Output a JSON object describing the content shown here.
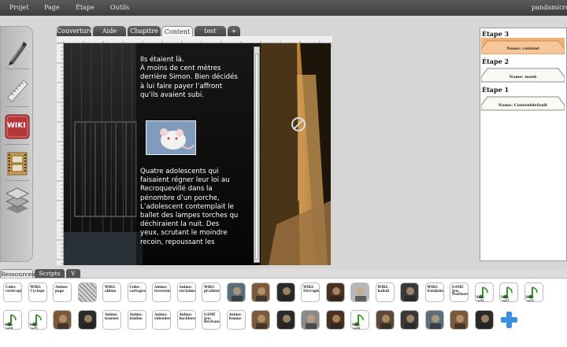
{
  "menubar": {
    "items": [
      "Projet",
      "Page",
      "Étape",
      "Outils"
    ],
    "user": "pandamicro"
  },
  "toolbox": {
    "tools": [
      "pen-icon",
      "ruler-icon",
      "wiki-icon",
      "film-icon",
      "layers-icon"
    ],
    "wiki_label": "WIKI"
  },
  "editor": {
    "tabs": [
      "Couverture",
      "Aide",
      "Chapitre",
      "Content",
      "test",
      "+"
    ],
    "active_tab": "Content",
    "story_paragraph_1": [
      "Ils étaient là.",
      "À moins de cent mètres",
      "derrière Simon. Bien décidés",
      "à lui faire payer l’affront",
      "qu’ils avaient subi."
    ],
    "story_paragraph_2": [
      "Quatre adolescents qui",
      "faisaient régner leur loi au",
      "Recroquevillé dans la",
      "pénombre d’un porche,",
      "L’adolescent contemplait le",
      "ballet des lampes torches qu",
      "déchiraient la nuit. Des",
      "yeux, scrutant le moindre",
      "recoin, repoussant les"
    ]
  },
  "steps": [
    {
      "title": "Étape 3",
      "name": "Name: content",
      "active": true
    },
    {
      "title": "Étape 2",
      "name": "Name: mask",
      "active": false
    },
    {
      "title": "Étape 1",
      "name": "Name: Contentdefault",
      "active": false
    }
  ],
  "resource_tabs": [
    "Ressources",
    "Scripts",
    "V"
  ],
  "resources_row1": [
    {
      "label": "Cube: verticepts",
      "kind": "text"
    },
    {
      "label": "WIKI: Cyclope",
      "kind": "text"
    },
    {
      "label": "Anime: page",
      "kind": "text"
    },
    {
      "label": "",
      "kind": "pattern"
    },
    {
      "label": "WIKI: albino",
      "kind": "text"
    },
    {
      "label": "Cube: cartographe",
      "kind": "text"
    },
    {
      "label": "Anime: traverslaine",
      "kind": "text"
    },
    {
      "label": "Anime: exclaime",
      "kind": "text"
    },
    {
      "label": "WIKI: pCalisture",
      "kind": "text"
    },
    {
      "label": "",
      "kind": "image"
    },
    {
      "label": "",
      "kind": "image"
    },
    {
      "label": "",
      "kind": "image"
    },
    {
      "label": "WIKI: Nécrophile",
      "kind": "text"
    },
    {
      "label": "",
      "kind": "image"
    },
    {
      "label": "",
      "kind": "image"
    },
    {
      "label": "WIKI: hallali",
      "kind": "text"
    },
    {
      "label": "",
      "kind": "image"
    },
    {
      "label": "WIKI: Fondation",
      "kind": "text"
    },
    {
      "label": "GAME Jeu: Posthurne",
      "kind": "text"
    },
    {
      "label": "Son: swl1",
      "kind": "sound"
    },
    {
      "label": "Son: swl2",
      "kind": "sound"
    },
    {
      "label": "Son: swl3",
      "kind": "sound"
    }
  ],
  "resources_row2": [
    {
      "label": "Son: swl4",
      "kind": "sound"
    },
    {
      "label": "Son: swl5",
      "kind": "sound"
    },
    {
      "label": "",
      "kind": "image"
    },
    {
      "label": "",
      "kind": "image"
    },
    {
      "label": "Anime: tourner",
      "kind": "text"
    },
    {
      "label": "Anime: fondue",
      "kind": "text"
    },
    {
      "label": "Anime: videodew",
      "kind": "text"
    },
    {
      "label": "Anime: backfore",
      "kind": "text"
    },
    {
      "label": "GAME Jeu: Revivance",
      "kind": "text"
    },
    {
      "label": "Anime: femme",
      "kind": "text"
    },
    {
      "label": "",
      "kind": "image"
    },
    {
      "label": "",
      "kind": "image"
    },
    {
      "label": "",
      "kind": "image"
    },
    {
      "label": "",
      "kind": "image"
    },
    {
      "label": "Son: swl6",
      "kind": "sound"
    },
    {
      "label": "",
      "kind": "image"
    },
    {
      "label": "",
      "kind": "image"
    },
    {
      "label": "",
      "kind": "image"
    },
    {
      "label": "",
      "kind": "image"
    },
    {
      "label": "",
      "kind": "image"
    },
    {
      "label": "",
      "kind": "add"
    }
  ]
}
